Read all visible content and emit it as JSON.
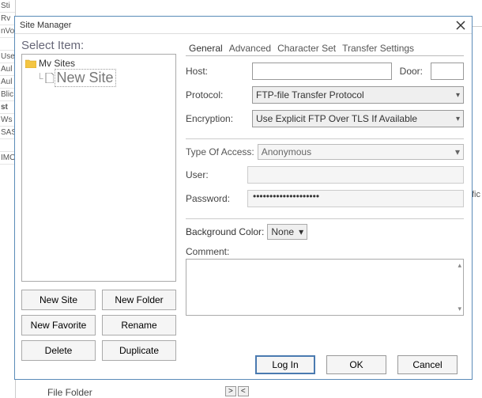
{
  "dialog": {
    "title": "Site Manager",
    "close_icon": "close"
  },
  "left": {
    "select_label": "Select Item:",
    "tree": {
      "root": "Mv Sites",
      "child": "New Site"
    },
    "buttons": {
      "new_site": "New Site",
      "new_folder": "New Folder",
      "new_favorite": "New Favorite",
      "rename": "Rename",
      "delete": "Delete",
      "duplicate": "Duplicate"
    }
  },
  "tabs": {
    "general": "General",
    "advanced": "Advanced",
    "charset": "Character Set",
    "transfer": "Transfer Settings"
  },
  "form": {
    "host_label": "Host:",
    "host_value": "",
    "door_label": "Door:",
    "door_value": "",
    "protocol_label": "Protocol:",
    "protocol_value": "FTP-file Transfer Protocol",
    "encryption_label": "Encryption:",
    "encryption_value": "Use Explicit FTP Over TLS If Available",
    "access_label": "Type Of Access:",
    "access_value": "Anonymous",
    "user_label": "User:",
    "user_value": "",
    "password_label": "Password:",
    "password_value": "••••••••••••••••••••",
    "bgcolor_label": "Background Color:",
    "bgcolor_value": "None",
    "comment_label": "Comment:",
    "comment_value": ""
  },
  "footer": {
    "login": "Log In",
    "ok": "OK",
    "cancel": "Cancel"
  },
  "background": {
    "left_items": [
      "Sti",
      "Rv",
      "nVo",
      "",
      "Use",
      "Aul",
      "Aul",
      "Blic",
      "st",
      "Ws",
      "SAS",
      "",
      "IMO"
    ],
    "bottom_label": "File Folder",
    "traffic_cut": "ffic"
  }
}
